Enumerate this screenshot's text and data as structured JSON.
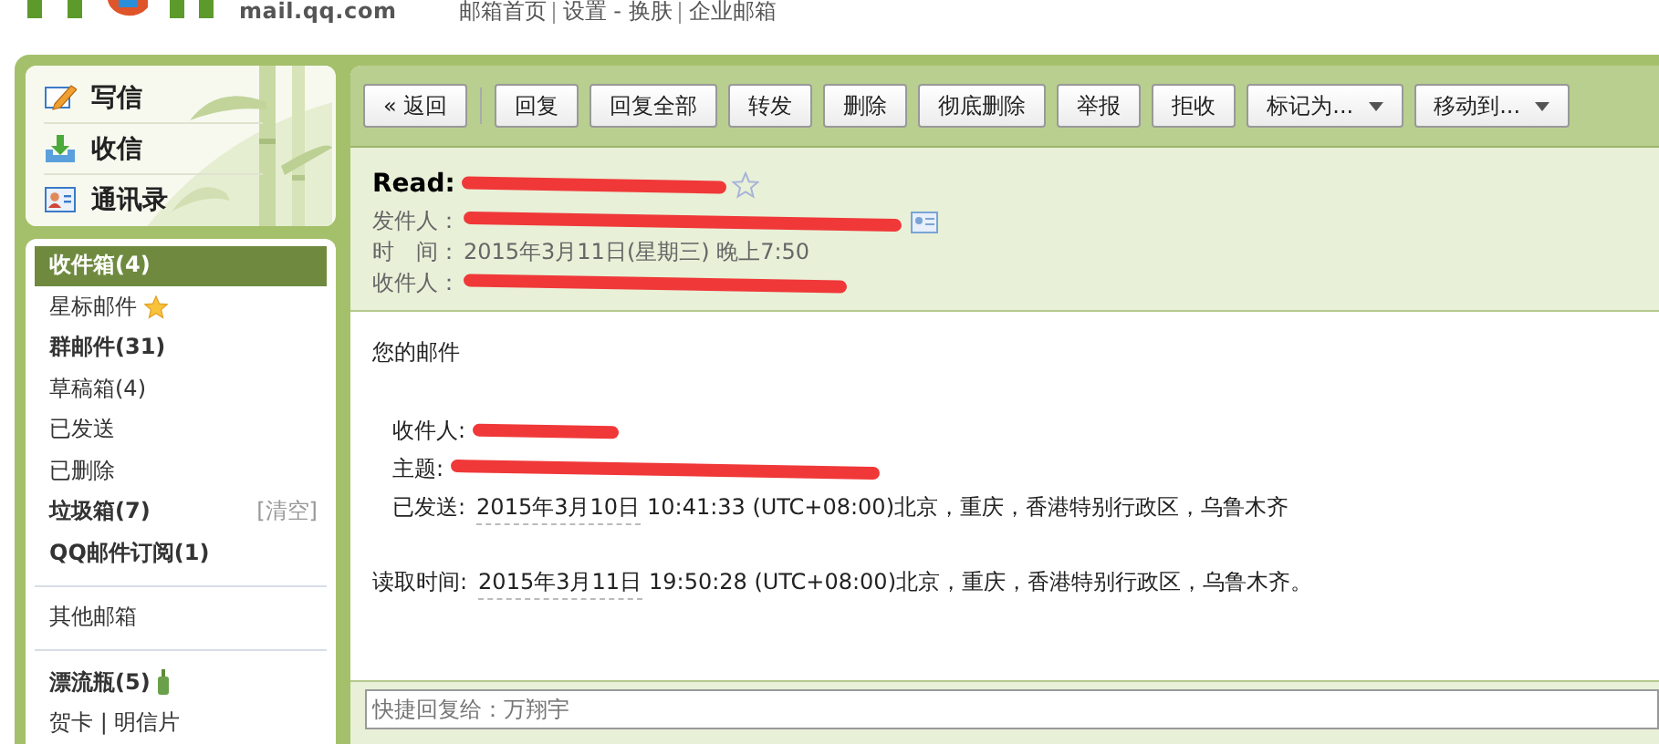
{
  "header": {
    "domain": "mail.qq.com",
    "links": [
      "邮箱首页",
      "设置 - 换肤",
      "企业邮箱"
    ]
  },
  "quick_nav": [
    {
      "kind": "compose",
      "label": "写信"
    },
    {
      "kind": "inbox",
      "label": "收信"
    },
    {
      "kind": "contacts",
      "label": "通讯录"
    }
  ],
  "folder_groups": [
    [
      {
        "label": "收件箱(4)",
        "selected": true,
        "unread": true
      },
      {
        "label": "星标邮件",
        "selected": false,
        "unread": false,
        "kind": "star"
      },
      {
        "label": "群邮件(31)",
        "selected": false,
        "unread": true
      },
      {
        "label": "草稿箱(4)",
        "selected": false,
        "unread": false
      },
      {
        "label": "已发送",
        "selected": false,
        "unread": false
      },
      {
        "label": "已删除",
        "selected": false,
        "unread": false
      },
      {
        "label": "垃圾箱(7)",
        "selected": false,
        "unread": true,
        "action": "[清空]"
      },
      {
        "label": "QQ邮件订阅(1)",
        "selected": false,
        "unread": true
      }
    ],
    [
      {
        "label": "其他邮箱",
        "selected": false,
        "unread": false
      }
    ],
    [
      {
        "label": "漂流瓶(5)",
        "selected": false,
        "unread": true,
        "kind": "bottle"
      },
      {
        "label": "贺卡  |  明信片",
        "selected": false,
        "unread": false
      }
    ]
  ],
  "toolbar": [
    {
      "label": "« 返回",
      "dropdown": false
    },
    {
      "label": "回复",
      "dropdown": false
    },
    {
      "label": "回复全部",
      "dropdown": false
    },
    {
      "label": "转发",
      "dropdown": false
    },
    {
      "label": "删除",
      "dropdown": false
    },
    {
      "label": "彻底删除",
      "dropdown": false
    },
    {
      "label": "举报",
      "dropdown": false
    },
    {
      "label": "拒收",
      "dropdown": false
    },
    {
      "label": "标记为...",
      "dropdown": true
    },
    {
      "label": "移动到...",
      "dropdown": true
    }
  ],
  "message": {
    "subject": "Read:",
    "starred": false,
    "fields": [
      {
        "label": "发件人：",
        "redacted": true
      },
      {
        "label": "时　间：",
        "value": "2015年3月11日(星期三) 晚上7:50"
      },
      {
        "label": "收件人：",
        "redacted": true
      }
    ],
    "body": [
      {
        "kind": "para",
        "label": "您的邮件"
      },
      {
        "kind": "field",
        "label": "收件人:",
        "redacted": true
      },
      {
        "kind": "field",
        "label": "主题:",
        "redacted": true
      },
      {
        "kind": "field",
        "label": "已发送:",
        "date": "2015年3月10日",
        "value": "10:41:33 (UTC+08:00)北京，重庆，香港特别行政区，乌鲁木齐"
      },
      {
        "kind": "read",
        "label": "读取时间:",
        "date": "2015年3月11日",
        "value": "19:50:28 (UTC+08:00)北京，重庆，香港特别行政区，乌鲁木齐。"
      }
    ]
  },
  "quick_reply": {
    "placeholder": "快捷回复给：万翔宇"
  }
}
